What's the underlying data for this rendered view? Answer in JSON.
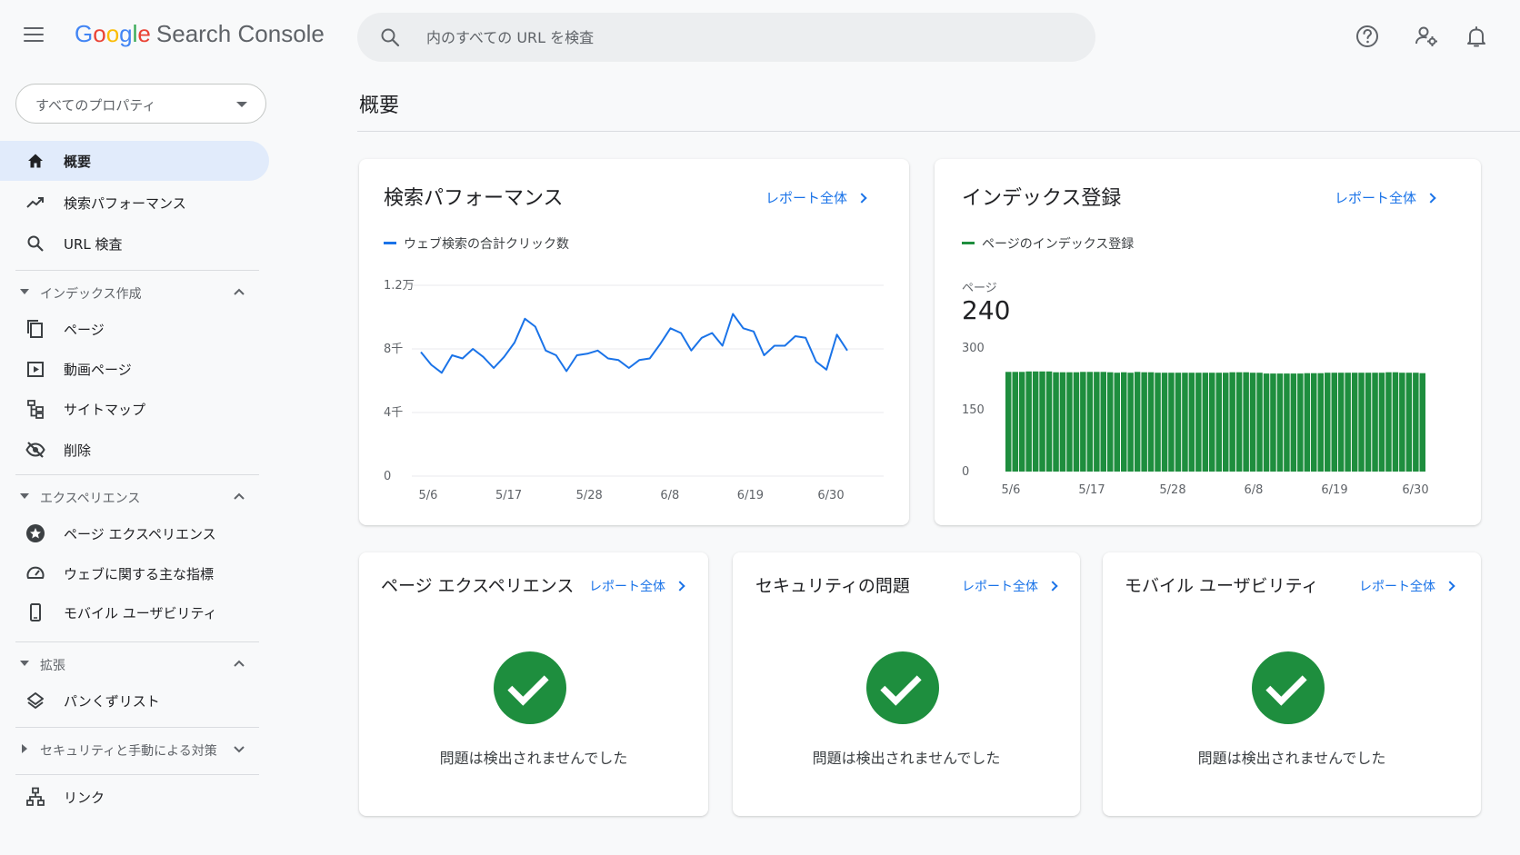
{
  "app": {
    "logo_google": [
      "G",
      "o",
      "o",
      "g",
      "l",
      "e"
    ],
    "logo_product": "Search Console"
  },
  "search": {
    "placeholder": "内のすべての URL を検査"
  },
  "property_selector": {
    "label": "すべてのプロパティ"
  },
  "sidebar": {
    "items": [
      {
        "label": "概要",
        "icon": "home-icon",
        "active": true
      },
      {
        "label": "検索パフォーマンス",
        "icon": "trending-up-icon"
      },
      {
        "label": "URL 検査",
        "icon": "search-icon"
      }
    ],
    "sections": [
      {
        "label": "インデックス作成",
        "expanded": true,
        "items": [
          {
            "label": "ページ",
            "icon": "pages-icon"
          },
          {
            "label": "動画ページ",
            "icon": "video-page-icon"
          },
          {
            "label": "サイトマップ",
            "icon": "sitemap-icon"
          },
          {
            "label": "削除",
            "icon": "eye-off-icon"
          }
        ]
      },
      {
        "label": "エクスペリエンス",
        "expanded": true,
        "items": [
          {
            "label": "ページ エクスペリエンス",
            "icon": "star-badge-icon"
          },
          {
            "label": "ウェブに関する主な指標",
            "icon": "gauge-icon"
          },
          {
            "label": "モバイル ユーザビリティ",
            "icon": "smartphone-icon"
          }
        ]
      },
      {
        "label": "拡張",
        "expanded": true,
        "items": [
          {
            "label": "パンくずリスト",
            "icon": "layers-icon"
          }
        ]
      },
      {
        "label": "セキュリティと手動による対策",
        "expanded": false,
        "items": []
      }
    ],
    "links_item": {
      "label": "リンク",
      "icon": "links-icon"
    }
  },
  "main": {
    "title": "概要"
  },
  "cards": {
    "performance": {
      "title": "検索パフォーマンス",
      "report_link": "レポート全体",
      "legend": "ウェブ検索の合計クリック数"
    },
    "indexing": {
      "title": "インデックス登録",
      "report_link": "レポート全体",
      "legend": "ページのインデックス登録",
      "metric_label": "ページ",
      "metric_value": "240"
    },
    "page_experience": {
      "title": "ページ エクスペリエンス",
      "report_link": "レポート全体",
      "status": "問題は検出されませんでした"
    },
    "security": {
      "title": "セキュリティの問題",
      "report_link": "レポート全体",
      "status": "問題は検出されませんでした"
    },
    "mobile": {
      "title": "モバイル ユーザビリティ",
      "report_link": "レポート全体",
      "status": "問題は検出されませんでした"
    }
  },
  "colors": {
    "accent": "#1a73e8",
    "line_series": "#1a73e8",
    "bar_series": "#1e8e3e",
    "success": "#1e8e3e"
  },
  "chart_data": [
    {
      "type": "line",
      "title": "",
      "series": [
        {
          "name": "ウェブ検索の合計クリック数",
          "values": [
            7800,
            7000,
            6500,
            7600,
            7400,
            8000,
            7500,
            6800,
            7500,
            8400,
            9900,
            9400,
            7900,
            7600,
            6600,
            7600,
            7700,
            7900,
            7400,
            7300,
            6800,
            7300,
            7400,
            8300,
            9300,
            9000,
            7900,
            8700,
            9000,
            8200,
            10200,
            9300,
            9100,
            7600,
            8200,
            8200,
            8800,
            8700,
            7200,
            6700,
            8900,
            7900
          ]
        }
      ],
      "x_ticks": [
        "5/6",
        "5/17",
        "5/28",
        "6/8",
        "6/19",
        "6/30"
      ],
      "y_ticks": [
        "0",
        "4千",
        "8千",
        "1.2万"
      ],
      "ylim": [
        0,
        12000
      ],
      "grid": true
    },
    {
      "type": "bar",
      "title": "",
      "series": [
        {
          "name": "ページのインデックス登録",
          "values": [
            242,
            242,
            242,
            243,
            243,
            243,
            243,
            241,
            241,
            241,
            241,
            242,
            242,
            242,
            242,
            241,
            240,
            241,
            240,
            242,
            241,
            241,
            240,
            240,
            240,
            240,
            240,
            240,
            240,
            240,
            240,
            240,
            240,
            241,
            241,
            241,
            240,
            240,
            238,
            238,
            238,
            238,
            238,
            238,
            239,
            239,
            239,
            240,
            240,
            240,
            240,
            240,
            240,
            240,
            240,
            240,
            241,
            241,
            240,
            240,
            240,
            239
          ]
        }
      ],
      "x_ticks": [
        "5/6",
        "5/17",
        "5/28",
        "6/8",
        "6/19",
        "6/30"
      ],
      "y_ticks": [
        "0",
        "150",
        "300"
      ],
      "ylim": [
        0,
        300
      ],
      "grid": false
    }
  ]
}
